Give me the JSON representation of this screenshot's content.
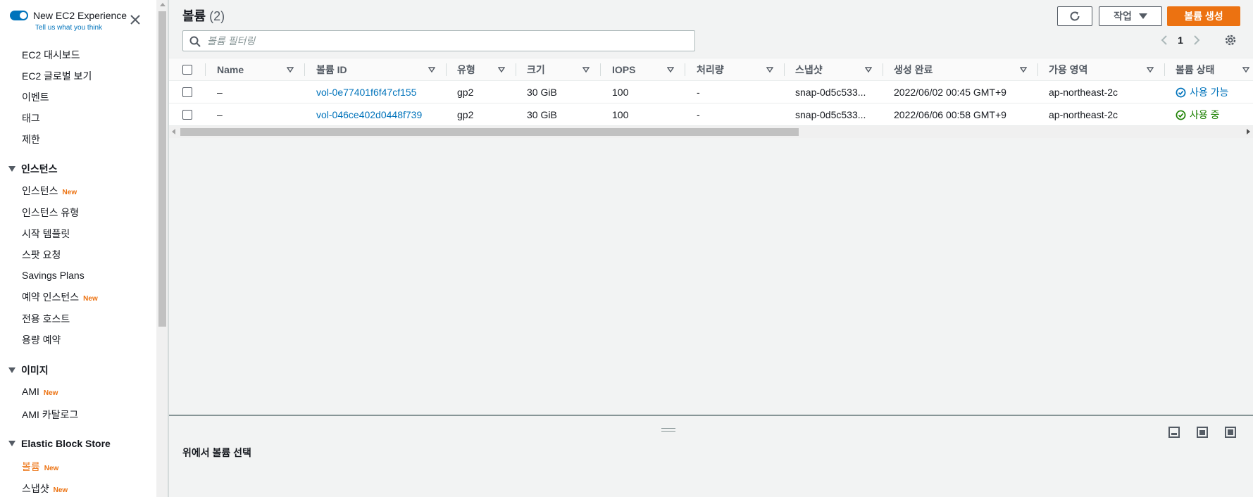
{
  "experience": {
    "title": "New EC2 Experience",
    "subtitle": "Tell us what you think"
  },
  "nav": {
    "top_items": [
      "EC2 대시보드",
      "EC2 글로벌 보기",
      "이벤트",
      "태그",
      "제한"
    ],
    "sections": [
      {
        "title": "인스턴스",
        "items": [
          {
            "label": "인스턴스",
            "new": "New"
          },
          {
            "label": "인스턴스 유형",
            "new": ""
          },
          {
            "label": "시작 템플릿",
            "new": ""
          },
          {
            "label": "스팟 요청",
            "new": ""
          },
          {
            "label": "Savings Plans",
            "new": ""
          },
          {
            "label": "예약 인스턴스",
            "new": "New"
          },
          {
            "label": "전용 호스트",
            "new": ""
          },
          {
            "label": "용량 예약",
            "new": ""
          }
        ]
      },
      {
        "title": "이미지",
        "items": [
          {
            "label": "AMI",
            "new": "New"
          },
          {
            "label": "AMI 카탈로그",
            "new": ""
          }
        ]
      },
      {
        "title": "Elastic Block Store",
        "items": [
          {
            "label": "볼륨",
            "new": "New",
            "active": true
          },
          {
            "label": "스냅샷",
            "new": "New"
          }
        ]
      }
    ]
  },
  "header": {
    "title": "볼륨",
    "count": "(2)",
    "actions_label": "작업",
    "create_label": "볼륨 생성"
  },
  "search": {
    "placeholder": "볼륨 필터링",
    "value": ""
  },
  "pagination": {
    "current_page": "1"
  },
  "table": {
    "columns": [
      "Name",
      "볼륨 ID",
      "유형",
      "크기",
      "IOPS",
      "처리량",
      "스냅샷",
      "생성 완료",
      "가용 영역",
      "볼륨 상태"
    ],
    "rows": [
      [
        "–",
        "vol-0e77401f6f47cf155",
        "gp2",
        "30 GiB",
        "100",
        "-",
        "snap-0d5c533...",
        "2022/06/02 00:45 GMT+9",
        "ap-northeast-2c",
        "사용 가능"
      ],
      [
        "–",
        "vol-046ce402d0448f739",
        "gp2",
        "30 GiB",
        "100",
        "-",
        "snap-0d5c533...",
        "2022/06/06 00:58 GMT+9",
        "ap-northeast-2c",
        "사용 중"
      ]
    ]
  },
  "details_panel": {
    "title": "위에서 볼륨 선택"
  },
  "colors": {
    "accent": "#ec7211",
    "link": "#0073bb",
    "in_use": "#1d8102"
  }
}
